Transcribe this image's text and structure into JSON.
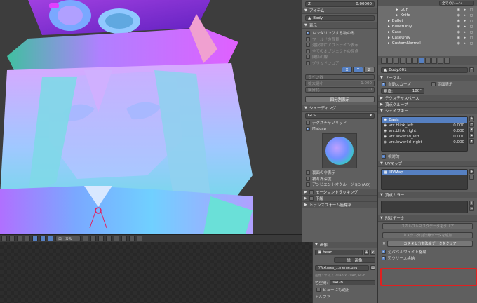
{
  "viewport": {
    "header": {
      "mode_label": "ローカル"
    }
  },
  "npanel": {
    "z_label": "Z:",
    "z_value": "0.00000",
    "item_header": "アイテム",
    "item_name": "Body",
    "display_header": "表示",
    "display_options": [
      {
        "label": "レンダリングする物のみ",
        "checked": true
      },
      {
        "label": "ワールドの背景",
        "checked": false
      },
      {
        "label": "選択物にアウトライン表示",
        "checked": false
      },
      {
        "label": "全てのオブジェクトの原点",
        "checked": false
      },
      {
        "label": "関係の線",
        "checked": false
      },
      {
        "label": "グリッドフロア",
        "checked": false
      }
    ],
    "axis_buttons": [
      "X",
      "Y",
      "Z"
    ],
    "grid_fields": [
      {
        "label": "ライン数",
        "value": ""
      },
      {
        "label": "拡大縮小",
        "value": "1.000"
      },
      {
        "label": "細分化",
        "value": "10"
      }
    ],
    "toggle_quad_button": "四分割表示",
    "shading_header": "シェーディング",
    "shading_mode": "GLSL",
    "shading_options": [
      {
        "label": "テクスチャソリッド",
        "checked": false
      },
      {
        "label": "Matcap",
        "checked": true
      }
    ],
    "shading_options2": [
      {
        "label": "裏面の非表示",
        "checked": false
      },
      {
        "label": "被写界深度",
        "checked": false
      },
      {
        "label": "アンビエントオクルージョン(AO)",
        "checked": false
      }
    ],
    "motion_tracking": "モーショントラッキング",
    "other_header": "下絵",
    "transform_orient": "トランスフォーム座標系",
    "image_header": "画像",
    "image_name": "head",
    "single_image": "単一画像",
    "image_file": "//Textures_...merge.png",
    "image_info": "画像: サイズ 2048 x 2048, RGB...",
    "color_space_label": "色空間:",
    "color_space_value": "sRGB",
    "view_as_render": "ビューにも適用",
    "alpha_label": "アルファ"
  },
  "outliner": {
    "rows": [
      "Gun",
      "Knife",
      "Bullet",
      "BulletOnly",
      "Case",
      "CaseOnly",
      "CustomNormal"
    ],
    "top_label": "全てのシーン"
  },
  "properties": {
    "object_name": "Body.001",
    "normals_header": "ノーマル",
    "auto_smooth": "自動スムーズ",
    "double_sided": "両面表示",
    "angle_label": "角度:",
    "angle_value": "180°",
    "texture_space": "テクスチャスペース",
    "vertex_groups": "頂点グループ",
    "shape_keys_header": "シェイプキー",
    "shape_keys": [
      {
        "name": "Basis",
        "value": "",
        "selected": true
      },
      {
        "name": "vrc.blink_left",
        "value": "0.000",
        "selected": false
      },
      {
        "name": "vrc.blink_right",
        "value": "0.000",
        "selected": false
      },
      {
        "name": "vrc.lowerlid_left",
        "value": "0.000",
        "selected": false
      },
      {
        "name": "vrc.lowerlid_right",
        "value": "0.000",
        "selected": false
      }
    ],
    "relative": "相対的",
    "uv_maps_header": "UVマップ",
    "uv_maps": [
      {
        "name": "UVMap",
        "selected": true
      }
    ],
    "vertex_colors": "頂点カラー",
    "geometry_data_header": "形状データ",
    "clear_skin": "スカルプトマスクデータをクリア",
    "clear_custom_split": "カスタム分割法線データをクリア",
    "add_custom_split": "カスタム分割法線データを追加",
    "store_bevel_weight": "辺ベベルウェイト格納",
    "store_crease": "辺クリース格納"
  }
}
